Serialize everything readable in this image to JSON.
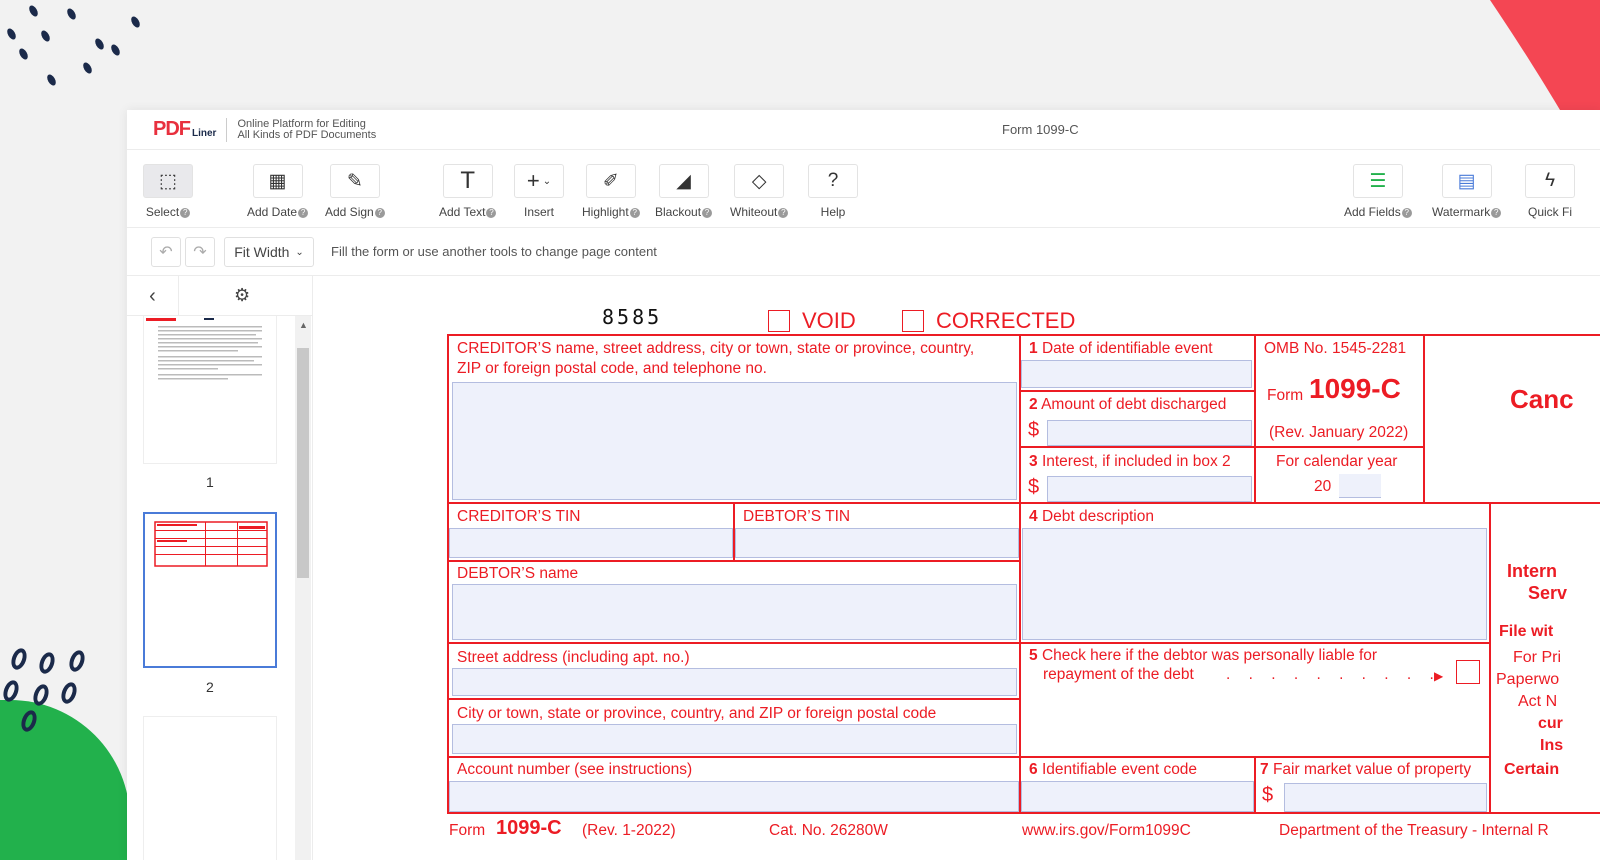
{
  "app": {
    "logo_pdf": "PDF",
    "logo_liner": "Liner",
    "tagline_1": "Online Platform for Editing",
    "tagline_2": "All Kinds of PDF Documents",
    "doc_title": "Form 1099-C"
  },
  "toolbar": {
    "select": "Select",
    "add_date": "Add Date",
    "add_sign": "Add Sign",
    "add_text": "Add Text",
    "insert": "Insert",
    "highlight": "Highlight",
    "blackout": "Blackout",
    "whiteout": "Whiteout",
    "help": "Help",
    "add_fields": "Add Fields",
    "watermark": "Watermark",
    "quick_fill": "Quick Fi"
  },
  "subbar": {
    "zoom": "Fit Width",
    "hint": "Fill the form or use another tools to change page content"
  },
  "sidebar": {
    "page_1": "1",
    "page_2": "2"
  },
  "form": {
    "code": "8585",
    "void": "VOID",
    "corrected": "CORRECTED",
    "creditor_name_1": "CREDITOR’S name, street address, city or town, state or province, country,",
    "creditor_name_2": "ZIP or foreign postal code, and telephone no.",
    "box1_num": "1",
    "box1": "Date of identifiable event",
    "box2_num": "2",
    "box2": "Amount of debt discharged",
    "box3_num": "3",
    "box3": "Interest, if included in box 2",
    "dollar": "$",
    "omb": "OMB No. 1545-2281",
    "form_word": "Form",
    "form_num": "1099-C",
    "rev": "(Rev. January 2022)",
    "calendar": "For calendar year",
    "year_prefix": "20",
    "cancel_partial": "Canc",
    "creditor_tin": "CREDITOR’S TIN",
    "debtor_tin": "DEBTOR’S TIN",
    "box4_num": "4",
    "box4": "Debt description",
    "debtor_name": "DEBTOR’S name",
    "street": "Street address (including apt. no.)",
    "box5_num": "5",
    "box5_1": "Check here if the debtor was personally liable for",
    "box5_2": "repayment of the debt",
    "box5_dots": ". . . . . . . . . .",
    "arrow": "▶",
    "city": "City or town, state or province, country, and ZIP or foreign postal code",
    "account": "Account number (see instructions)",
    "box6_num": "6",
    "box6": "Identifiable event code",
    "box7_num": "7",
    "box7": "Fair market value of property",
    "right_intern": "Intern",
    "right_serv": "Serv",
    "right_file": "File wit",
    "right_forpri": "For Pri",
    "right_paperw": "Paperwo",
    "right_actn": "Act N",
    "right_cur": "cur",
    "right_ins": "Ins",
    "right_certain": "Certain",
    "footer_form": "Form",
    "footer_num": "1099-C",
    "footer_rev": "(Rev. 1-2022)",
    "footer_cat": "Cat. No. 26280W",
    "footer_url": "www.irs.gov/Form1099C",
    "footer_dept": "Department of the Treasury - Internal R"
  },
  "colors": {
    "form_red": "#ec1c24",
    "field_bg": "#eef1fb",
    "accent_blue": "#4a7bd8"
  }
}
